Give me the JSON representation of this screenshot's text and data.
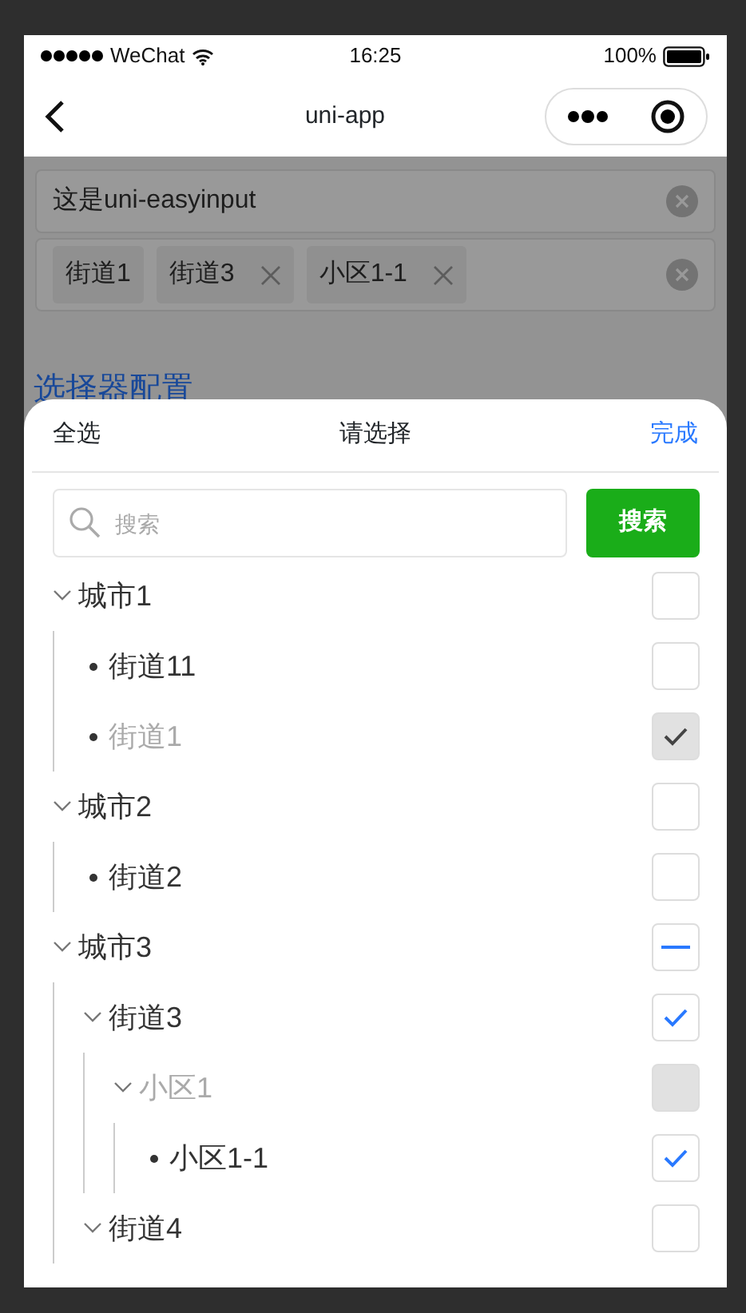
{
  "status_bar": {
    "carrier": "WeChat",
    "time": "16:25",
    "battery": "100%"
  },
  "nav_bar": {
    "title": "uni-app"
  },
  "form": {
    "input": {
      "value": "这是uni-easyinput"
    },
    "tags": [
      {
        "label": "街道1",
        "removable": false
      },
      {
        "label": "街道3",
        "removable": true
      },
      {
        "label": "小区1-1",
        "removable": true
      }
    ],
    "section_title": "选择器配置"
  },
  "picker": {
    "select_all": "全选",
    "title": "请选择",
    "done": "完成",
    "search": {
      "placeholder": "搜索",
      "button": "搜索"
    },
    "tree": [
      {
        "label": "城市1",
        "kind": "branch",
        "expanded": true,
        "checked": false,
        "indeterminate": false,
        "disabled": false,
        "children": [
          {
            "label": "街道11",
            "kind": "leaf",
            "checked": false,
            "indeterminate": false,
            "disabled": false
          },
          {
            "label": "街道1",
            "kind": "leaf",
            "checked": true,
            "indeterminate": false,
            "disabled": true
          }
        ]
      },
      {
        "label": "城市2",
        "kind": "branch",
        "expanded": true,
        "checked": false,
        "indeterminate": false,
        "disabled": false,
        "children": [
          {
            "label": "街道2",
            "kind": "leaf",
            "checked": false,
            "indeterminate": false,
            "disabled": false
          }
        ]
      },
      {
        "label": "城市3",
        "kind": "branch",
        "expanded": true,
        "checked": false,
        "indeterminate": true,
        "disabled": false,
        "children": [
          {
            "label": "街道3",
            "kind": "branch",
            "expanded": true,
            "checked": true,
            "indeterminate": false,
            "disabled": false,
            "children": [
              {
                "label": "小区1",
                "kind": "branch",
                "expanded": true,
                "checked": false,
                "indeterminate": false,
                "disabled": true,
                "children": [
                  {
                    "label": "小区1-1",
                    "kind": "leaf",
                    "checked": true,
                    "indeterminate": false,
                    "disabled": false
                  }
                ]
              }
            ]
          },
          {
            "label": "街道4",
            "kind": "branch",
            "expanded": true,
            "checked": false,
            "indeterminate": false,
            "disabled": false
          }
        ]
      }
    ]
  }
}
